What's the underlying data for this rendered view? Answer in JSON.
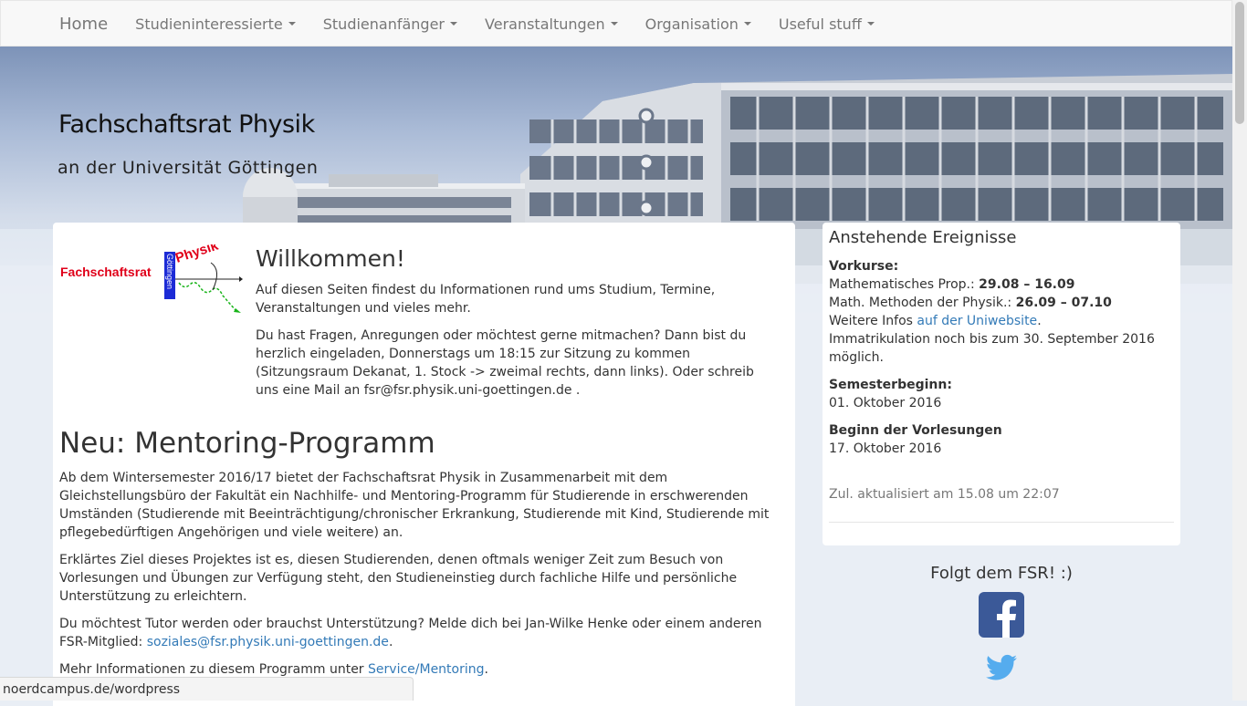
{
  "nav": {
    "items": [
      {
        "label": "Home",
        "dropdown": false
      },
      {
        "label": "Studieninteressierte",
        "dropdown": true
      },
      {
        "label": "Studienanfänger",
        "dropdown": true
      },
      {
        "label": "Veranstaltungen",
        "dropdown": true
      },
      {
        "label": "Organisation",
        "dropdown": true
      },
      {
        "label": "Useful stuff",
        "dropdown": true
      }
    ]
  },
  "header": {
    "title": "Fachschaftsrat Physik",
    "subtitle": "an der Universität Göttingen"
  },
  "logo": {
    "text_left": "Fachschaftsrat",
    "text_vertical": "Göttingen",
    "text_right": "Physik"
  },
  "welcome": {
    "heading": "Willkommen!",
    "p1": "Auf diesen Seiten findest du Informationen rund ums Studium, Termine, Veranstaltungen und vieles mehr.",
    "p2": "Du hast Fragen, Anregungen oder möchtest gerne mitmachen? Dann bist du herzlich eingeladen, Donnerstags um 18:15 zur Sitzung zu kommen (Sitzungsraum Dekanat, 1. Stock -> zweimal rechts, dann links). Oder schreib uns eine Mail an fsr@fsr.physik.uni-goettingen.de ."
  },
  "mentoring": {
    "heading": "Neu: Mentoring-Programm",
    "p1": "Ab dem Wintersemester 2016/17 bietet der Fachschaftsrat Physik in Zusammenarbeit mit dem Gleichstellungsbüro der Fakultät ein Nachhilfe- und Mentoring-Programm für Studierende in erschwerenden Umständen (Studierende mit Beeinträchtigung/chronischer Erkrankung, Studierende mit Kind, Studierende mit pflegebedürftigen Angehörigen und viele weitere) an.",
    "p2": "Erklärtes Ziel dieses Projektes ist es, diesen Studierenden, denen oftmals weniger Zeit zum Besuch von Vorlesungen und Übungen zur Verfügung steht, den Studieneinstieg durch fachliche Hilfe und persönliche Unterstützung zu erleichtern.",
    "p3_text": "Du möchtest Tutor werden oder brauchst Unterstützung? Melde dich bei Jan-Wilke Henke oder einem anderen FSR-Mitglied: ",
    "p3_link": "soziales@fsr.physik.uni-goettingen.de",
    "p3_end": ".",
    "p4_text": "Mehr Informationen zu diesem Programm unter ",
    "p4_link": "Service/Mentoring",
    "p4_end": "."
  },
  "events": {
    "title": "Anstehende Ereignisse",
    "vorkurse_label": "Vorkurse:",
    "mathe_prop_label": "Mathematisches Prop.: ",
    "mathe_prop_dates": "29.08 – 16.09",
    "math_methoden_label": "Math. Methoden der Physik.: ",
    "math_methoden_dates": "26.09 – 07.10",
    "infos_text": "Weitere Infos ",
    "infos_link": "auf der Uniwebsite",
    "infos_end": ".",
    "immatrikulation": "Immatrikulation noch bis zum 30. September 2016 möglich.",
    "semesterbeginn_label": "Semesterbeginn:",
    "semesterbeginn_date": "01. Oktober 2016",
    "vorlesungen_label": "Beginn der Vorlesungen",
    "vorlesungen_date": "17. Oktober 2016",
    "updated": "Zul. aktualisiert am 15.08 um 22:07"
  },
  "social": {
    "heading": "Folgt dem FSR! :)",
    "icons": [
      "facebook-icon",
      "twitter-icon"
    ],
    "facebook_color": "#3b5998",
    "twitter_color": "#55acee"
  },
  "statusbar": {
    "url": "noerdcampus.de/wordpress"
  }
}
